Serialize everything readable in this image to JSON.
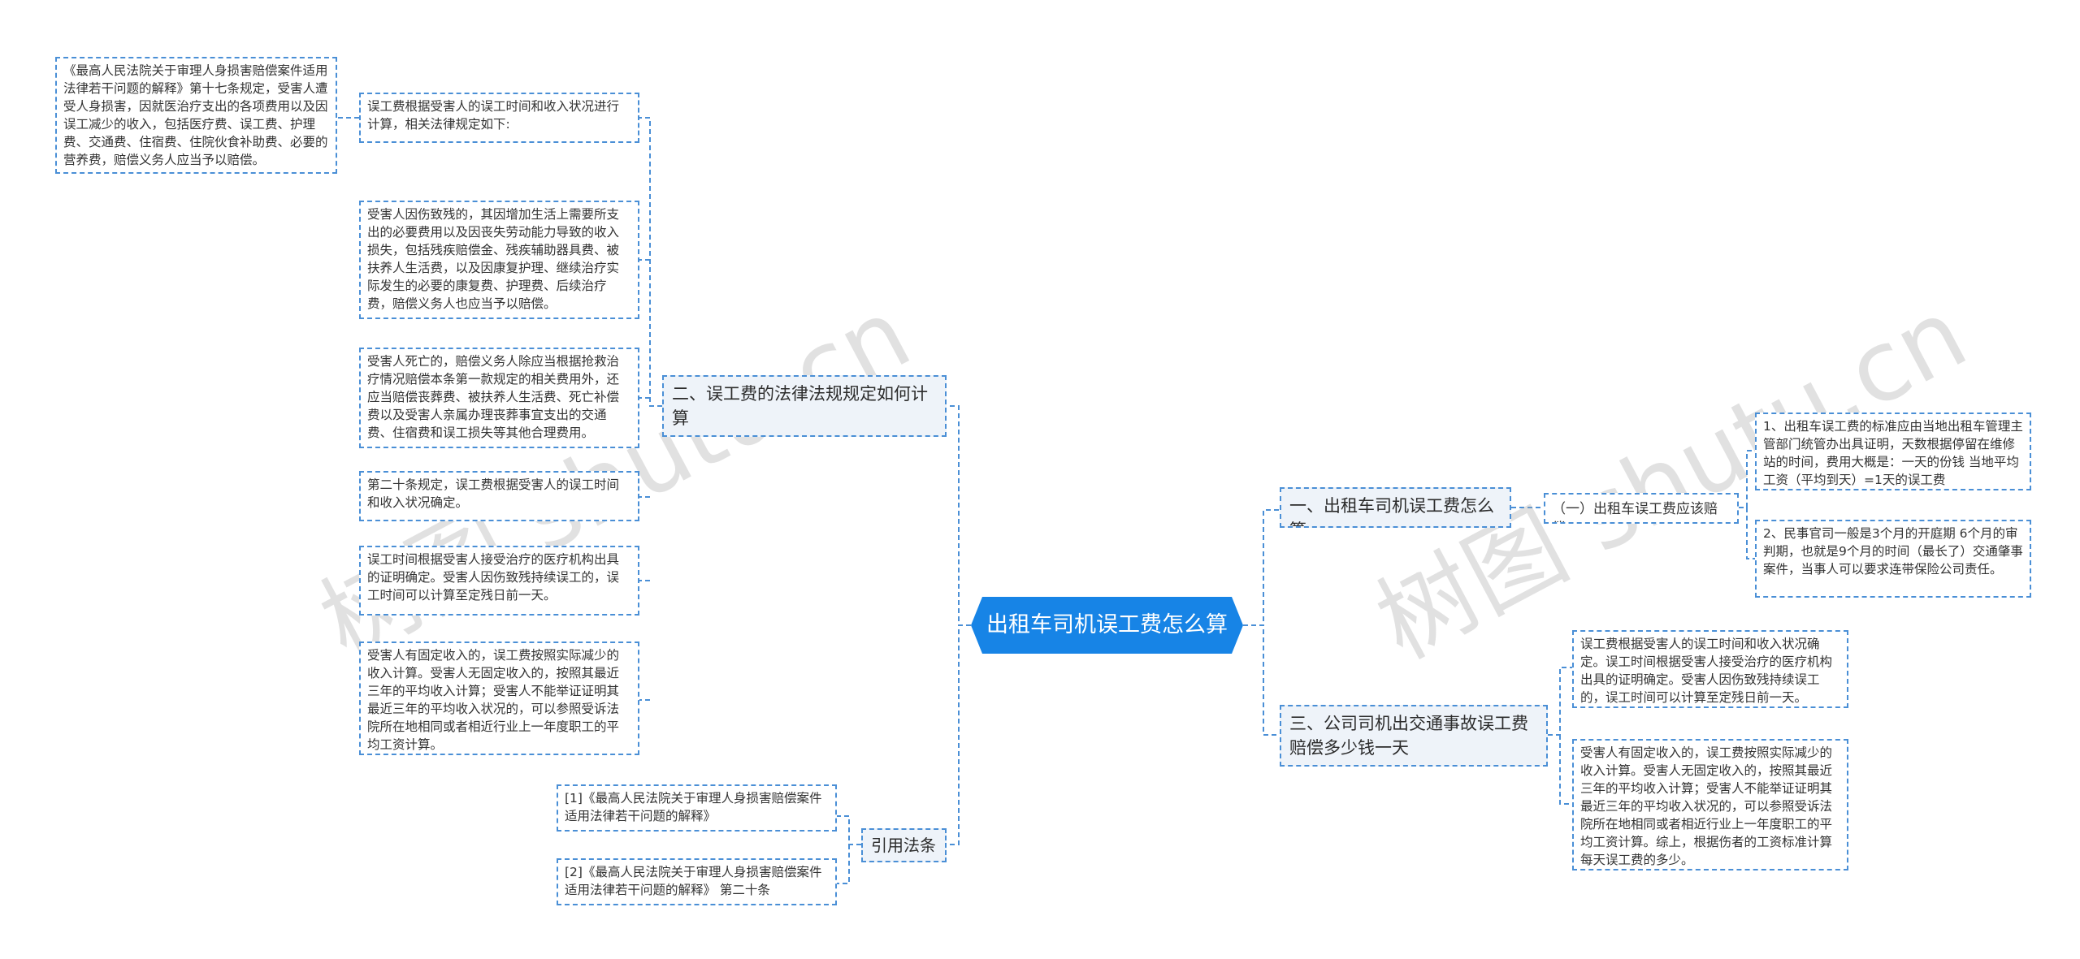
{
  "root": {
    "title": "出租车司机误工费怎么算"
  },
  "branches": {
    "b1": {
      "label": "一、出租车司机误工费怎么算",
      "sub": "（一）出租车误工费应该赔偿。",
      "leaves": [
        "1、出租车误工费的标准应由当地出租车管理主管部门统管办出具证明，天数根据停留在维修站的时间，费用大概是：一天的份钱 当地平均工资（平均到天）=1天的误工费",
        "2、民事官司一般是3个月的开庭期 6个月的审判期，也就是9个月的时间（最长了）交通肇事案件，当事人可以要求连带保险公司责任。"
      ]
    },
    "b2": {
      "label": "二、误工费的法律法规规定如何计算",
      "leaves": [
        "误工费根据受害人的误工时间和收入状况进行计算，相关法律规定如下:",
        "受害人因伤致残的，其因增加生活上需要所支出的必要费用以及因丧失劳动能力导致的收入损失，包括残疾赔偿金、残疾辅助器具费、被扶养人生活费，以及因康复护理、继续治疗实际发生的必要的康复费、护理费、后续治疗费，赔偿义务人也应当予以赔偿。",
        "受害人死亡的，赔偿义务人除应当根据抢救治疗情况赔偿本条第一款规定的相关费用外，还应当赔偿丧葬费、被扶养人生活费、死亡补偿费以及受害人亲属办理丧葬事宜支出的交通费、住宿费和误工损失等其他合理费用。",
        "第二十条规定，误工费根据受害人的误工时间和收入状况确定。",
        "误工时间根据受害人接受治疗的医疗机构出具的证明确定。受害人因伤致残持续误工的，误工时间可以计算至定残日前一天。",
        "受害人有固定收入的，误工费按照实际减少的收入计算。受害人无固定收入的，按照其最近三年的平均收入计算；受害人不能举证证明其最近三年的平均收入状况的，可以参照受诉法院所在地相同或者相近行业上一年度职工的平均工资计算。"
      ],
      "sub_leaf": "《最高人民法院关于审理人身损害赔偿案件适用法律若干问题的解释》第十七条规定，受害人遭受人身损害，因就医治疗支出的各项费用以及因误工减少的收入，包括医疗费、误工费、护理费、交通费、住宿费、住院伙食补助费、必要的营养费，赔偿义务人应当予以赔偿。"
    },
    "b3": {
      "label": "三、公司司机出交通事故误工费赔偿多少钱一天",
      "leaves": [
        "误工费根据受害人的误工时间和收入状况确定。误工时间根据受害人接受治疗的医疗机构出具的证明确定。受害人因伤致残持续误工的，误工时间可以计算至定残日前一天。",
        "受害人有固定收入的，误工费按照实际减少的收入计算。受害人无固定收入的，按照其最近三年的平均收入计算；受害人不能举证证明其最近三年的平均收入状况的，可以参照受诉法院所在地相同或者相近行业上一年度职工的平均工资计算。综上，根据伤者的工资标准计算每天误工费的多少。"
      ]
    },
    "b4": {
      "label": "引用法条",
      "leaves": [
        "[1]《最高人民法院关于审理人身损害赔偿案件适用法律若干问题的解释》",
        "[2]《最高人民法院关于审理人身损害赔偿案件适用法律若干问题的解释》 第二十条"
      ]
    }
  },
  "watermarks": [
    "树图 shutu.cn",
    "树图 shutu.cn"
  ],
  "colors": {
    "accent": "#1784e6",
    "line": "#4a8fd6",
    "branch_bg": "#eef3f9"
  }
}
